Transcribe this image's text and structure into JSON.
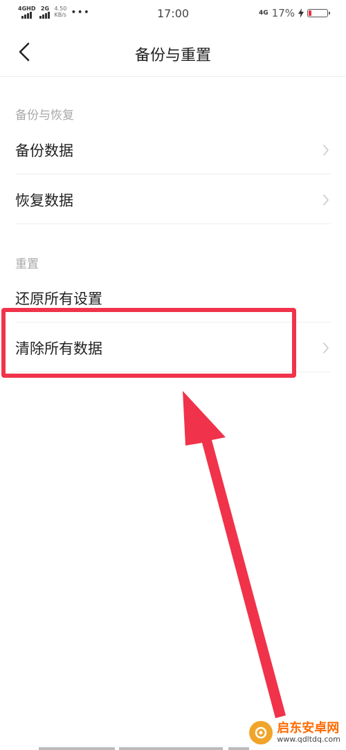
{
  "status_bar": {
    "net1_label": "4GHD",
    "net2_label": "2G",
    "speed_value": "4.50",
    "speed_unit": "KB/s",
    "more": "•••",
    "time": "17:00",
    "net_right": "4G",
    "battery_percent": "17%",
    "battery_level": 0.17,
    "battery_color": "#e8333e"
  },
  "header": {
    "title": "备份与重置",
    "back_icon": "chevron-left-icon"
  },
  "sections": [
    {
      "label": "备份与恢复",
      "items": [
        {
          "label": "备份数据"
        },
        {
          "label": "恢复数据"
        }
      ]
    },
    {
      "label": "重置",
      "items": [
        {
          "label": "还原所有设置"
        },
        {
          "label": "清除所有数据"
        }
      ]
    }
  ],
  "annotation": {
    "color": "#f0334a"
  },
  "watermark": {
    "name": "启东安卓网",
    "url": "www.qdltdq.com"
  }
}
